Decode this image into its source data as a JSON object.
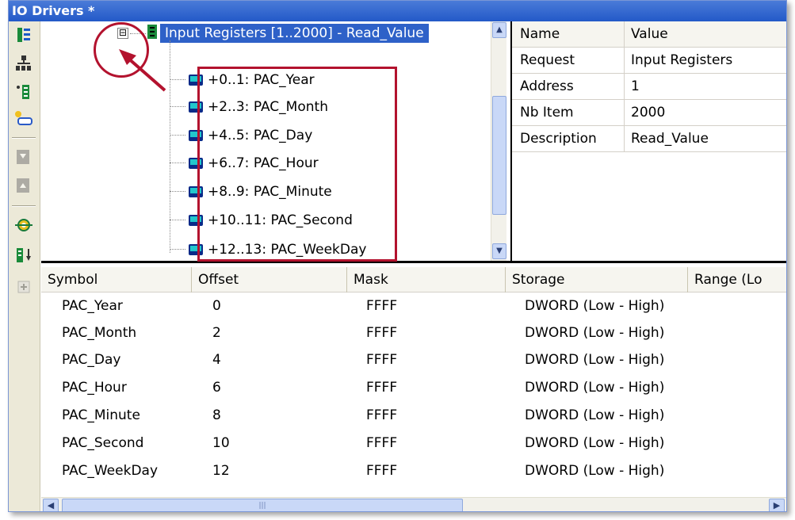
{
  "window": {
    "title": "IO Drivers *"
  },
  "tree": {
    "root_label": "Input Registers [1..2000] - Read_Value",
    "expander": "⊟",
    "items": [
      "+0..1: PAC_Year",
      "+2..3: PAC_Month",
      "+4..5: PAC_Day",
      "+6..7: PAC_Hour",
      "+8..9: PAC_Minute",
      "+10..11: PAC_Second",
      "+12..13: PAC_WeekDay"
    ]
  },
  "properties": {
    "header": {
      "name": "Name",
      "value": "Value"
    },
    "rows": [
      {
        "name": "Request",
        "value": "Input Registers"
      },
      {
        "name": "Address",
        "value": "1"
      },
      {
        "name": "Nb Item",
        "value": "2000"
      },
      {
        "name": "Description",
        "value": "Read_Value"
      }
    ]
  },
  "grid": {
    "columns": [
      "Symbol",
      "Offset",
      "Mask",
      "Storage",
      "Range (Lo"
    ],
    "rows": [
      [
        "PAC_Year",
        "0",
        "FFFF",
        "DWORD (Low - High)"
      ],
      [
        "PAC_Month",
        "2",
        "FFFF",
        "DWORD (Low - High)"
      ],
      [
        "PAC_Day",
        "4",
        "FFFF",
        "DWORD (Low - High)"
      ],
      [
        "PAC_Hour",
        "6",
        "FFFF",
        "DWORD (Low - High)"
      ],
      [
        "PAC_Minute",
        "8",
        "FFFF",
        "DWORD (Low - High)"
      ],
      [
        "PAC_Second",
        "10",
        "FFFF",
        "DWORD (Low - High)"
      ],
      [
        "PAC_WeekDay",
        "12",
        "FFFF",
        "DWORD (Low - High)"
      ]
    ]
  },
  "colors": {
    "accent": "#2e61c8",
    "annotation": "#b3122e",
    "register_icon": "#22c7cc"
  },
  "toolbar_icons": [
    "tree-view-icon",
    "network-icon",
    "add-register-icon",
    "add-driver-icon",
    "move-down-icon",
    "move-up-icon",
    "settings-icon",
    "sort-icon",
    "expand-icon"
  ]
}
